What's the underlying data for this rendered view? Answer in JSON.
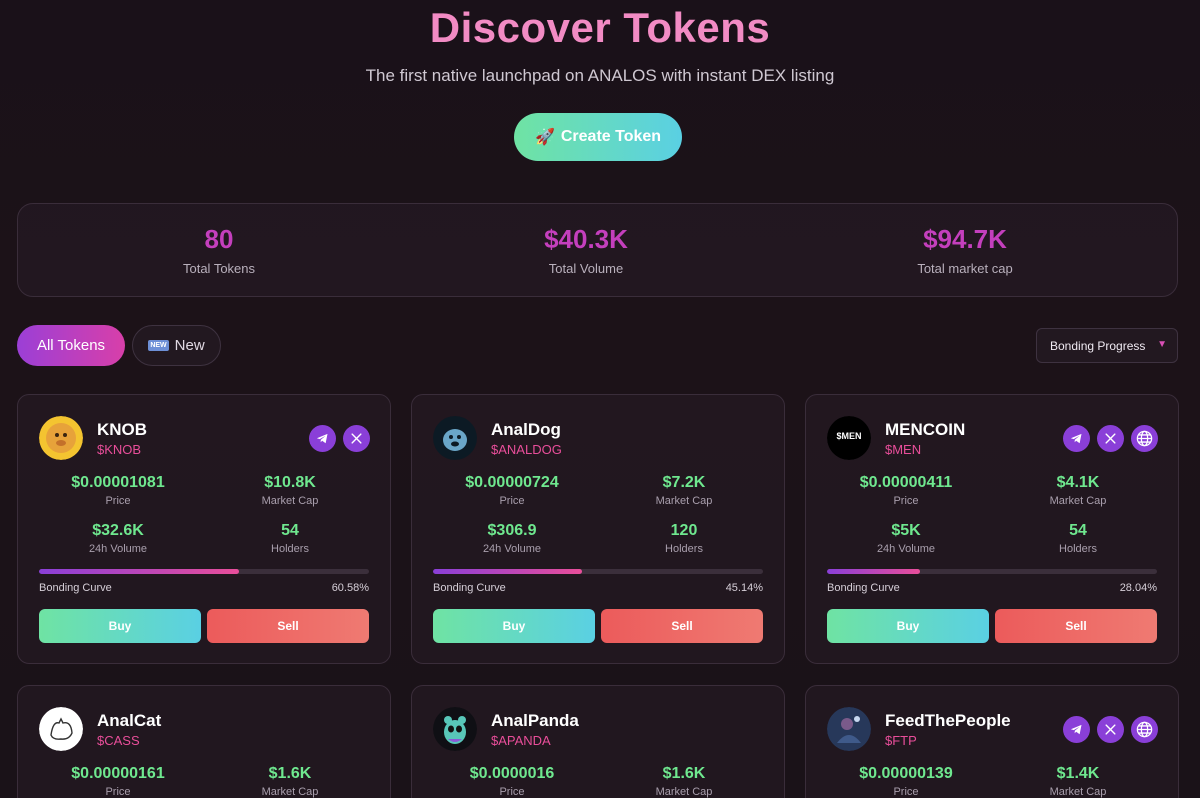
{
  "hero": {
    "title": "Discover Tokens",
    "subtitle": "The first native launchpad on ANALOS with instant DEX listing",
    "create_label": "Create Token",
    "create_icon": "🚀"
  },
  "stats": [
    {
      "value": "80",
      "label": "Total Tokens"
    },
    {
      "value": "$40.3K",
      "label": "Total Volume"
    },
    {
      "value": "$94.7K",
      "label": "Total market cap"
    }
  ],
  "filters": {
    "all_label": "All Tokens",
    "new_label": "New",
    "new_badge": "NEW",
    "sort_value": "Bonding Progress"
  },
  "labels": {
    "price": "Price",
    "market_cap": "Market Cap",
    "volume": "24h Volume",
    "holders": "Holders",
    "bonding": "Bonding Curve",
    "buy": "Buy",
    "sell": "Sell"
  },
  "tokens": [
    {
      "name": "KNOB",
      "symbol": "$KNOB",
      "price": "$0.00001081",
      "market_cap": "$10.8K",
      "volume": "$32.6K",
      "holders": "54",
      "progress": "60.58%",
      "progress_value": 60.58,
      "socials": [
        "telegram-icon",
        "x-icon"
      ],
      "avatar": "knob-logo"
    },
    {
      "name": "AnalDog",
      "symbol": "$ANALDOG",
      "price": "$0.00000724",
      "market_cap": "$7.2K",
      "volume": "$306.9",
      "holders": "120",
      "progress": "45.14%",
      "progress_value": 45.14,
      "socials": [],
      "avatar": "analdog-logo"
    },
    {
      "name": "MENCOIN",
      "symbol": "$MEN",
      "price": "$0.00000411",
      "market_cap": "$4.1K",
      "volume": "$5K",
      "holders": "54",
      "progress": "28.04%",
      "progress_value": 28.04,
      "socials": [
        "telegram-icon",
        "x-icon",
        "globe-icon"
      ],
      "avatar": "mencoin-logo",
      "avatar_text": "$MEN"
    },
    {
      "name": "AnalCat",
      "symbol": "$CASS",
      "price": "$0.00000161",
      "market_cap": "$1.6K",
      "socials": [],
      "avatar": "analcat-logo"
    },
    {
      "name": "AnalPanda",
      "symbol": "$APANDA",
      "price": "$0.0000016",
      "market_cap": "$1.6K",
      "socials": [],
      "avatar": "analpanda-logo"
    },
    {
      "name": "FeedThePeople",
      "symbol": "$FTP",
      "price": "$0.00000139",
      "market_cap": "$1.4K",
      "socials": [
        "telegram-icon",
        "x-icon",
        "globe-icon"
      ],
      "avatar": "feedthepeople-logo"
    }
  ],
  "colors": {
    "background": "#1a1119",
    "title_pink": "#f28bc4",
    "stat_magenta": "#c43fbd",
    "metric_green": "#6fe88f",
    "symbol_pink": "#e94e9a",
    "social_purple": "#8a3fd8",
    "buy_gradient": "#6fe3a3",
    "sell_red": "#ec5b5b"
  }
}
